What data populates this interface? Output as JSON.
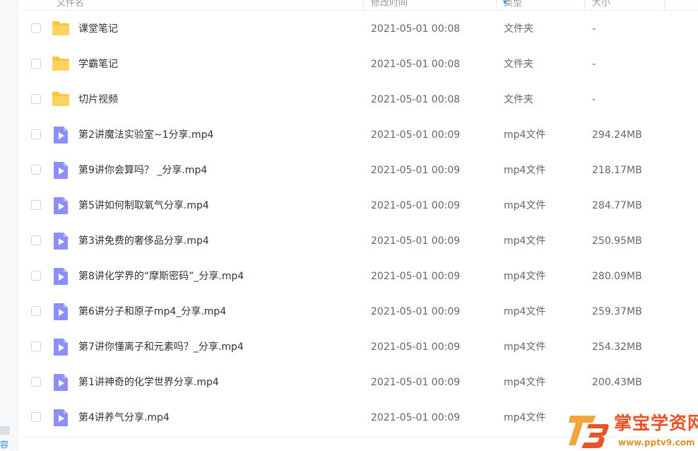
{
  "header": {
    "columns": [
      "文件名",
      "修改时间",
      "类型",
      "大小"
    ]
  },
  "files": [
    {
      "name": "课堂笔记",
      "time": "2021-05-01 00:08",
      "type": "文件夹",
      "size": "-",
      "icon": "folder-icon"
    },
    {
      "name": "学霸笔记",
      "time": "2021-05-01 00:08",
      "type": "文件夹",
      "size": "-",
      "icon": "folder-icon"
    },
    {
      "name": "切片视频",
      "time": "2021-05-01 00:08",
      "type": "文件夹",
      "size": "-",
      "icon": "folder-icon"
    },
    {
      "name": "第2讲魔法实验室~1分享.mp4",
      "time": "2021-05-01 00:09",
      "type": "mp4文件",
      "size": "294.24MB",
      "icon": "video-file-icon"
    },
    {
      "name": "第9讲你会算吗？ _分享.mp4",
      "time": "2021-05-01 00:09",
      "type": "mp4文件",
      "size": "218.17MB",
      "icon": "video-file-icon"
    },
    {
      "name": "第5讲如何制取氧气分享.mp4",
      "time": "2021-05-01 00:09",
      "type": "mp4文件",
      "size": "284.77MB",
      "icon": "video-file-icon"
    },
    {
      "name": "第3讲免费的奢侈品分享.mp4",
      "time": "2021-05-01 00:09",
      "type": "mp4文件",
      "size": "250.95MB",
      "icon": "video-file-icon"
    },
    {
      "name": "第8讲化学界的“摩斯密码”_分享.mp4",
      "time": "2021-05-01 00:09",
      "type": "mp4文件",
      "size": "280.09MB",
      "icon": "video-file-icon"
    },
    {
      "name": "第6讲分子和原子mp4_分享.mp4",
      "time": "2021-05-01 00:09",
      "type": "mp4文件",
      "size": "259.37MB",
      "icon": "video-file-icon"
    },
    {
      "name": "第7讲你懂离子和元素吗？_分享.mp4",
      "time": "2021-05-01 00:09",
      "type": "mp4文件",
      "size": "254.32MB",
      "icon": "video-file-icon"
    },
    {
      "name": "第1讲神奇的化学世界分享.mp4",
      "time": "2021-05-01 00:09",
      "type": "mp4文件",
      "size": "200.43MB",
      "icon": "video-file-icon"
    },
    {
      "name": "第4讲养气分享.mp4",
      "time": "2021-05-01 00:09",
      "type": "mp4文件",
      "size": "",
      "icon": "video-file-icon"
    }
  ],
  "left_strip": {
    "glyph": "容"
  },
  "watermark": {
    "title": "掌宝学资网",
    "url": "www.pptv9.com"
  },
  "colors": {
    "folder": "#ffc53d",
    "video_icon": "#8c8ff7",
    "accent": "#2a8cf0",
    "watermark_red": "#e8542a",
    "watermark_gold": "#d9932e"
  }
}
